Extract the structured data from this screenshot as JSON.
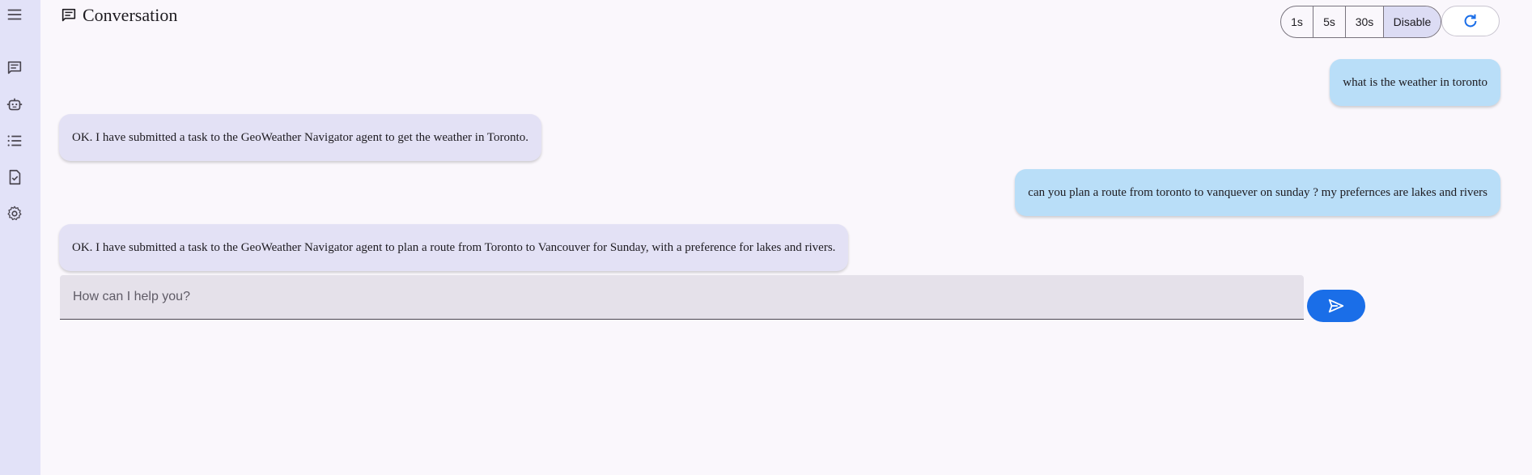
{
  "header": {
    "title": "Conversation",
    "refresh_options": [
      "1s",
      "5s",
      "30s",
      "Disable"
    ],
    "selected_refresh": "Disable"
  },
  "sidebar": {
    "items": [
      {
        "icon": "menu-icon"
      },
      {
        "icon": "conversation-icon"
      },
      {
        "icon": "agent-icon"
      },
      {
        "icon": "list-icon"
      },
      {
        "icon": "task-icon"
      },
      {
        "icon": "settings-icon"
      }
    ]
  },
  "messages": [
    {
      "role": "user",
      "text": "what is the weather in toronto"
    },
    {
      "role": "agent",
      "text": "OK. I have submitted a task to the GeoWeather Navigator agent to get the weather in Toronto."
    },
    {
      "role": "user",
      "text": "can you plan a route from toronto to vanquever on sunday ? my prefernces are lakes and rivers"
    },
    {
      "role": "agent",
      "text": "OK. I have submitted a task to the GeoWeather Navigator agent to plan a route from Toronto to Vancouver for Sunday, with a preference for lakes and rivers."
    }
  ],
  "composer": {
    "placeholder": "How can I help you?",
    "value": ""
  },
  "colors": {
    "sidebar_bg": "#e2e2f8",
    "user_bubble": "#b9def8",
    "agent_bubble": "#e3e1f5",
    "accent": "#1a6ee8"
  }
}
